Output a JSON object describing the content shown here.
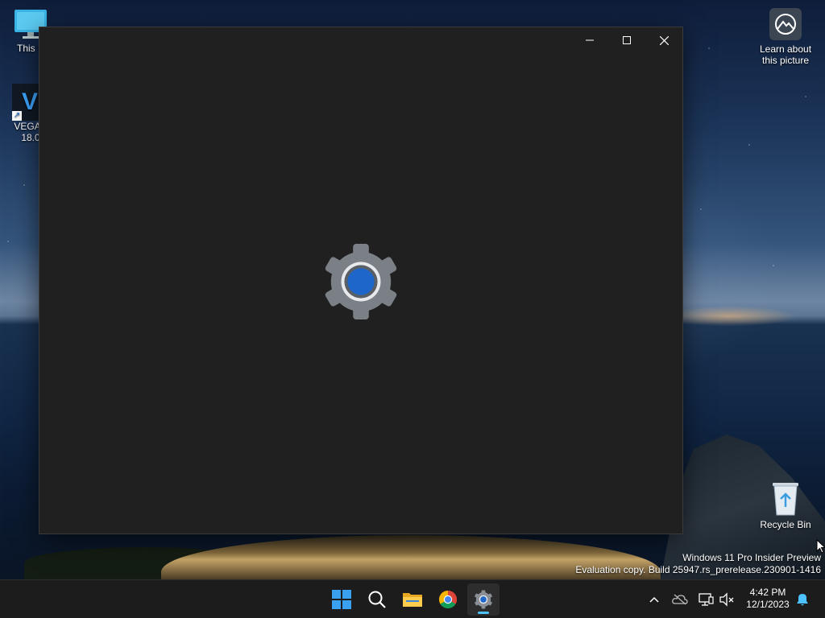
{
  "desktop": {
    "icons": [
      {
        "name": "this-pc",
        "label": "This P"
      },
      {
        "name": "vegas",
        "label": "VEGAS",
        "label2": "18.0"
      },
      {
        "name": "recycle-bin",
        "label": "Recycle Bin"
      },
      {
        "name": "learn-picture",
        "label": "Learn about this picture"
      }
    ]
  },
  "window": {
    "app": "Settings",
    "splash_icon": "settings-gear-icon",
    "controls": [
      "minimize",
      "maximize",
      "close"
    ]
  },
  "watermark": {
    "line1": "Windows 11 Pro Insider Preview",
    "line2": "Evaluation copy. Build 25947.rs_prerelease.230901-1416"
  },
  "taskbar": {
    "apps": [
      {
        "name": "start-button",
        "icon": "windows-logo-icon"
      },
      {
        "name": "search-button",
        "icon": "search-icon"
      },
      {
        "name": "file-explorer-button",
        "icon": "folder-icon"
      },
      {
        "name": "chrome-button",
        "icon": "chrome-icon"
      },
      {
        "name": "settings-button",
        "icon": "settings-gear-icon",
        "active": true
      }
    ],
    "tray": [
      "chevron-up-icon",
      "onedrive-offline-icon",
      "network-icon",
      "volume-muted-icon"
    ],
    "clock": {
      "time": "4:42 PM",
      "date": "12/1/2023"
    },
    "notification_icon": "bell-icon"
  },
  "colors": {
    "window_bg": "#202020",
    "taskbar_bg": "#1c1c1c",
    "accent": "#4cc2ff",
    "gear_outer": "#7a7e85",
    "gear_inner": "#1e66c9"
  }
}
